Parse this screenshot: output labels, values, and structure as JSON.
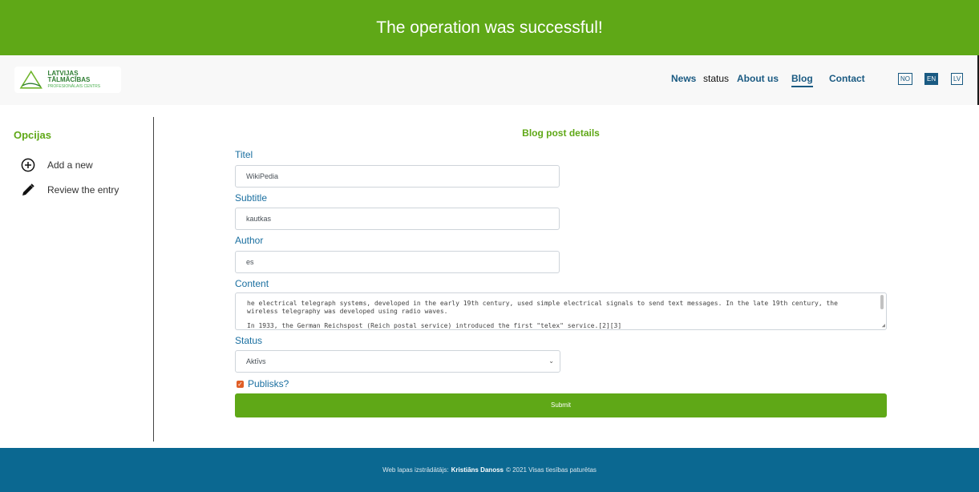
{
  "banner": {
    "message": "The operation was successful!"
  },
  "header": {
    "logo": {
      "line1": "LATVIJAS TĀLMĀCĪBAS",
      "line2": "PROFESIONĀLAIS CENTRS"
    },
    "nav": [
      {
        "label": "News"
      },
      {
        "label": "status"
      },
      {
        "label": "About us"
      },
      {
        "label": "Blog",
        "active": true
      },
      {
        "label": "Contact"
      }
    ],
    "languages": [
      {
        "label": "NO"
      },
      {
        "label": "EN",
        "active": true
      },
      {
        "label": "LV"
      }
    ]
  },
  "sidebar": {
    "title": "Opcijas",
    "items": [
      {
        "label": "Add a new",
        "icon": "plus-circle-icon"
      },
      {
        "label": "Review the entry",
        "icon": "pencil-icon"
      }
    ]
  },
  "form": {
    "title": "Blog post details",
    "fields": {
      "title": {
        "label": "Titel",
        "value": "WikiPedia"
      },
      "subtitle": {
        "label": "Subtitle",
        "value": "kautkas"
      },
      "author": {
        "label": "Author",
        "value": "es"
      },
      "content": {
        "label": "Content",
        "paragraph1": "he electrical telegraph systems, developed in the early 19th century, used simple electrical signals to send text messages. In the late 19th century, the wireless telegraphy was developed using radio waves.",
        "paragraph2": "In 1933, the German Reichspost (Reich postal service) introduced the first \"telex\" service.[2][3]"
      },
      "status": {
        "label": "Status",
        "value": "Aktīvs"
      },
      "public": {
        "label": "Publisks?",
        "checked": true
      }
    },
    "submit_label": "Submit"
  },
  "footer": {
    "prefix": "Web lapas izstrādātājs:",
    "author": "Kristiāns Danoss",
    "suffix": "© 2021 Visas tiesības paturētas"
  },
  "colors": {
    "accent_green": "#5fa817",
    "brand_blue": "#1a5a82",
    "footer_blue": "#0b6891",
    "checkbox": "#e05e26"
  }
}
